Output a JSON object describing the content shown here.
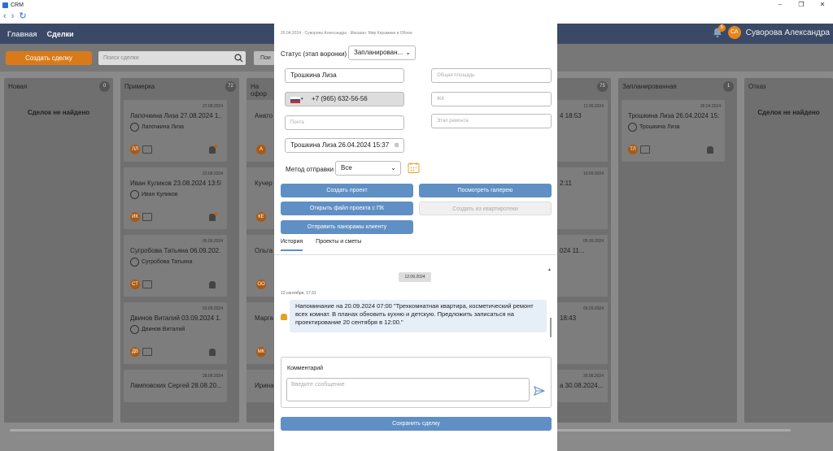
{
  "window": {
    "title": "CRM"
  },
  "topbar": {
    "nav_home": "Главная",
    "nav_deals": "Сделки",
    "notif_count": "5",
    "user_initials": "СА",
    "user_name": "Суворова Александра"
  },
  "toolbar": {
    "create_button": "Создать сделку",
    "search_placeholder": "Поиск сделки",
    "search_button": "Пои"
  },
  "columns": [
    {
      "name": "Новая",
      "count": "0",
      "empty": "Сделок не найдено"
    },
    {
      "name": "Примерка",
      "count": "72"
    },
    {
      "name": "На офор",
      "count": ""
    },
    {
      "name": "",
      "count": "75"
    },
    {
      "name": "Запланированная",
      "count": "1"
    },
    {
      "name": "Отказ",
      "count": "",
      "empty": "Сделок не найдено"
    }
  ],
  "cards_col2": [
    {
      "date": "27.08.2024",
      "title": "Лапочкина Лиза 27.08.2024 1...",
      "person": "Лапочкина Лиза",
      "initials": "ЛЛ"
    },
    {
      "date": "23.08.2024",
      "title": "Иван Куликов 23.08.2024 13:55",
      "person": "Иван Куликов",
      "initials": "ИК"
    },
    {
      "date": "06.09.2024",
      "title": "Сугробова Татьяна 06.09.202...",
      "person": "Сугробова Татьяна",
      "initials": "СТ"
    },
    {
      "date": "03.09.2024",
      "title": "Двинов Виталий 03.09.2024 1...",
      "person": "Двинов Виталий",
      "initials": "ДВ"
    },
    {
      "date": "28.08.2024",
      "title": "Ламповских Сергей 28.08.20...",
      "person": "",
      "initials": ""
    }
  ],
  "cards_col3": [
    {
      "title": "Анато",
      "initials": "А"
    },
    {
      "title": "Кучер",
      "initials": "КЕ"
    },
    {
      "title": "Ольга",
      "initials": "ОО"
    },
    {
      "title": "Марга",
      "initials": "МК"
    },
    {
      "title": "Ирина",
      "initials": ""
    }
  ],
  "cards_col4": [
    {
      "date": "11.09.2024",
      "title": "4 18:53"
    },
    {
      "date": "10.09.2024",
      "title": "2:11"
    },
    {
      "date": "05.09.2024",
      "title": "024 11..."
    },
    {
      "date": "06.09.2024",
      "title": "18:43"
    },
    {
      "date": "30.08.2024",
      "title": "а 30.08.2024..."
    }
  ],
  "cards_col5": [
    {
      "date": "26.04.2024",
      "title": "Трошкина Лиза 26.04.2024 15:...",
      "person": "Трошкина Лиза",
      "initials": "ТЛ"
    }
  ],
  "modal": {
    "crumb": "26.04.2024 · Суворова Александра · Магазин: Мир Керамики и Обоев",
    "status_label": "Статус (этап воронки)",
    "status_value": "Запланирован...",
    "client_name": "Трошкина Лиза",
    "phone": "+7 (965) 632-56-56",
    "email_placeholder": "Почта",
    "deal_name": "Трошкина Лиза 26.04.2024 15:37",
    "area_placeholder": "Общая площадь",
    "complex_placeholder": "ЖК",
    "stage_placeholder": "Этап ремонта",
    "send_method_label": "Метод отправки",
    "send_method_value": "Все",
    "btn_create_project": "Создать проект",
    "btn_view_gallery": "Посмотреть галерею",
    "btn_open_pc": "Открыть файл проекта с ПК",
    "btn_from_catalog": "Создать из квартиротеки",
    "btn_send_panoramas": "Отправить панорамы клиенту",
    "tab_history": "История",
    "tab_projects": "Проекты и сметы",
    "history_date": "12.09.2024",
    "msg_time": "12 сентября, 17:31",
    "msg_text": "Напоминание на 20.09.2024 07:00 \"Трехкомнатная квартира, косметический ремонт всех комнат. В планах обновить кухню и детскую. Предложить записаться на проектирование 20 сентября в 12:00.\"",
    "comment_title": "Комментарий",
    "comment_placeholder": "Введите сообщение",
    "save_button": "Сохранить сделку"
  },
  "colors": {
    "accent": "#5f8fc4",
    "orange": "#d97a1a",
    "topbar": "#3a4a66"
  }
}
